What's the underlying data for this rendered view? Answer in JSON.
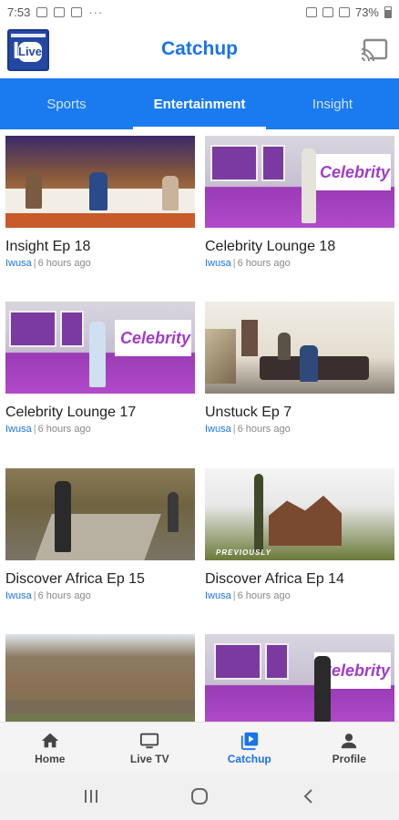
{
  "status_bar": {
    "time": "7:53",
    "battery": "73%"
  },
  "app": {
    "title": "Catchup",
    "logo_label": "Live"
  },
  "tabs": [
    {
      "label": "Sports",
      "active": false
    },
    {
      "label": "Entertainment",
      "active": true
    },
    {
      "label": "Insight",
      "active": false
    }
  ],
  "cards": [
    {
      "title": "Insight Ep 18",
      "author": "Iwusa",
      "time": "6 hours ago",
      "thumb": "studio"
    },
    {
      "title": "Celebrity Lounge 18",
      "author": "Iwusa",
      "time": "6 hours ago",
      "thumb": "pink"
    },
    {
      "title": "Celebrity Lounge 17",
      "author": "Iwusa",
      "time": "6 hours ago",
      "thumb": "pink"
    },
    {
      "title": "Unstuck Ep 7",
      "author": "Iwusa",
      "time": "6 hours ago",
      "thumb": "room"
    },
    {
      "title": "Discover Africa Ep 15",
      "author": "Iwusa",
      "time": "6 hours ago",
      "thumb": "forest"
    },
    {
      "title": "Discover Africa Ep 14",
      "author": "Iwusa",
      "time": "6 hours ago",
      "thumb": "church"
    },
    {
      "title": "",
      "author": "",
      "time": "",
      "thumb": "hills"
    },
    {
      "title": "",
      "author": "",
      "time": "",
      "thumb": "pink"
    }
  ],
  "thumb_text": {
    "celebrity_sign": "Celebrity",
    "previously": "PREVIOUSLY"
  },
  "bottom_nav": [
    {
      "label": "Home",
      "icon": "home-icon",
      "active": false
    },
    {
      "label": "Live TV",
      "icon": "tv-icon",
      "active": false
    },
    {
      "label": "Catchup",
      "icon": "catchup-icon",
      "active": true
    },
    {
      "label": "Profile",
      "icon": "profile-icon",
      "active": false
    }
  ],
  "colors": {
    "accent": "#1a73e8",
    "tab_bar": "#1a7bf0"
  }
}
